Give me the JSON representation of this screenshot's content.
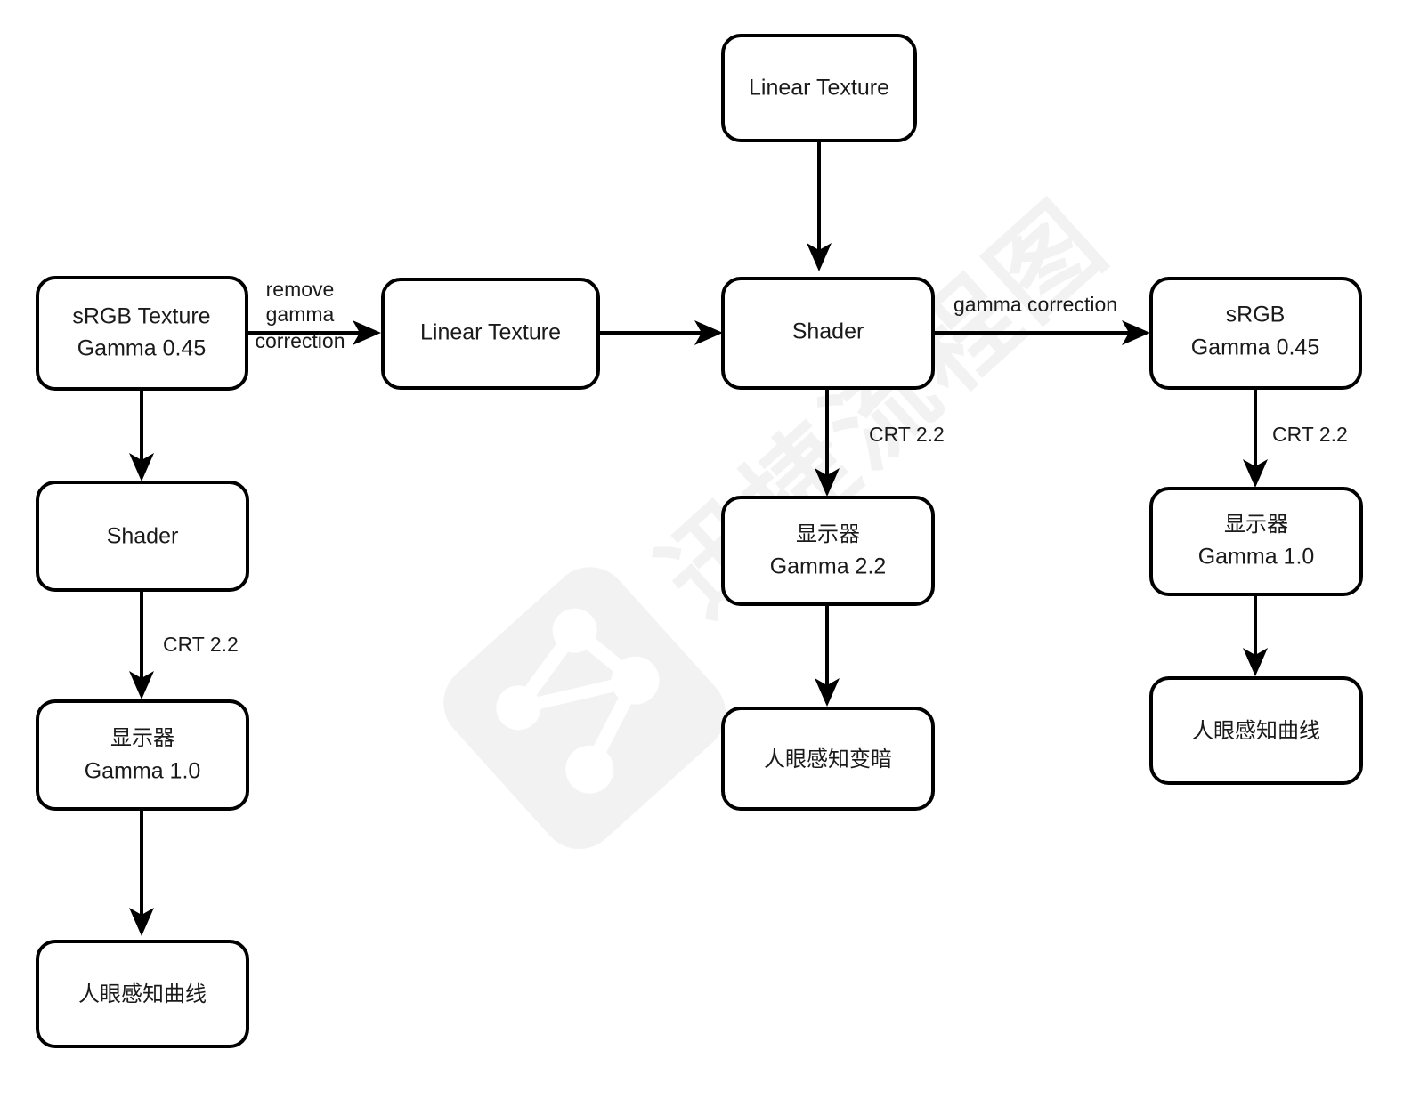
{
  "diagram": {
    "title": "Gamma Correction Pipeline Flowchart",
    "background_color": "#ffffff",
    "stroke_color": "#000000",
    "text_color": "#1a1a1a",
    "watermark": {
      "text": "迅捷流程图",
      "color": "#f2f2f2"
    },
    "nodes": {
      "top_linear_texture": {
        "line1": "Linear Texture",
        "line2": ""
      },
      "srgb_texture": {
        "line1": "sRGB Texture",
        "line2": "Gamma 0.45"
      },
      "mid_linear_texture": {
        "line1": "Linear Texture",
        "line2": ""
      },
      "shader_center": {
        "line1": "Shader",
        "line2": ""
      },
      "srgb_right": {
        "line1": "sRGB",
        "line2": "Gamma 0.45"
      },
      "shader_left": {
        "line1": "Shader",
        "line2": ""
      },
      "monitor_center": {
        "line1": "显示器",
        "line2": "Gamma 2.2"
      },
      "monitor_right": {
        "line1": "显示器",
        "line2": "Gamma 1.0"
      },
      "monitor_left": {
        "line1": "显示器",
        "line2": "Gamma 1.0"
      },
      "perception_left": {
        "line1": "人眼感知曲线",
        "line2": ""
      },
      "perception_center": {
        "line1": "人眼感知变暗",
        "line2": ""
      },
      "perception_right": {
        "line1": "人眼感知曲线",
        "line2": ""
      }
    },
    "edge_labels": {
      "remove_gamma_1": "remove",
      "remove_gamma_2": "gamma",
      "remove_gamma_3": "correction",
      "gamma_correction": "gamma correction",
      "crt_left": "CRT 2.2",
      "crt_center": "CRT 2.2",
      "crt_right": "CRT 2.2"
    }
  }
}
